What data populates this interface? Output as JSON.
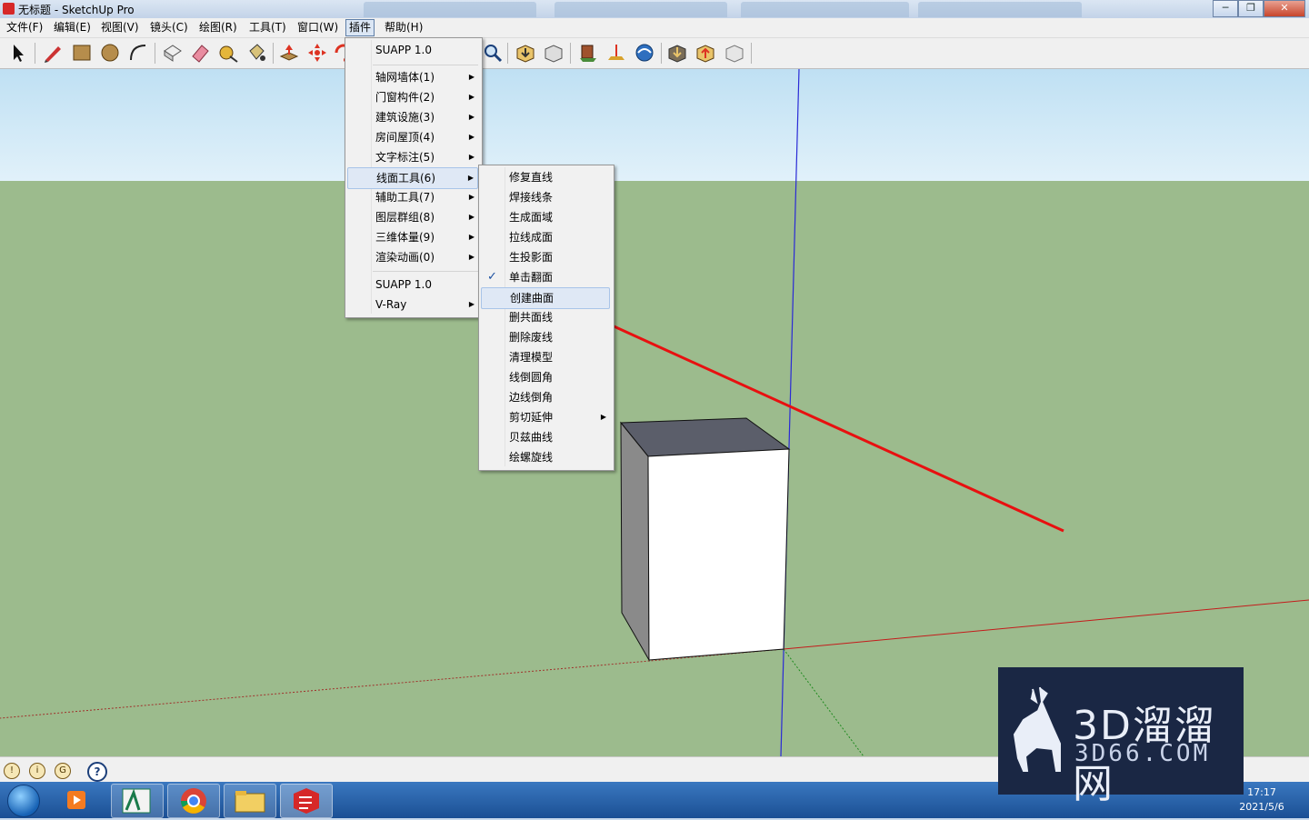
{
  "window": {
    "title": "无标题 - SketchUp Pro",
    "minimize": "─",
    "maximize": "❐",
    "close": "✕"
  },
  "menubar": [
    {
      "label": "文件(F)"
    },
    {
      "label": "编辑(E)"
    },
    {
      "label": "视图(V)"
    },
    {
      "label": "镜头(C)"
    },
    {
      "label": "绘图(R)"
    },
    {
      "label": "工具(T)"
    },
    {
      "label": "窗口(W)"
    },
    {
      "label": "插件",
      "active": true
    },
    {
      "label": "帮助(H)"
    }
  ],
  "plugin_menu": {
    "header": "SUAPP 1.0",
    "items": [
      {
        "label": "轴网墙体(1)",
        "submenu": true
      },
      {
        "label": "门窗构件(2)",
        "submenu": true
      },
      {
        "label": "建筑设施(3)",
        "submenu": true
      },
      {
        "label": "房间屋顶(4)",
        "submenu": true
      },
      {
        "label": "文字标注(5)",
        "submenu": true
      },
      {
        "label": "线面工具(6)",
        "submenu": true,
        "highlighted": true
      },
      {
        "label": "辅助工具(7)",
        "submenu": true
      },
      {
        "label": "图层群组(8)",
        "submenu": true
      },
      {
        "label": "三维体量(9)",
        "submenu": true
      },
      {
        "label": "渲染动画(0)",
        "submenu": true
      }
    ],
    "footer_items": [
      {
        "label": "SUAPP 1.0",
        "submenu": false
      },
      {
        "label": "V-Ray",
        "submenu": true
      }
    ]
  },
  "line_tools_submenu": [
    {
      "label": "修复直线"
    },
    {
      "label": "焊接线条"
    },
    {
      "label": "生成面域"
    },
    {
      "label": "拉线成面"
    },
    {
      "label": "生投影面"
    },
    {
      "label": "单击翻面",
      "checked": true
    },
    {
      "label": "创建曲面",
      "highlighted": true
    },
    {
      "label": "删共面线"
    },
    {
      "label": "删除废线"
    },
    {
      "label": "清理模型"
    },
    {
      "label": "线倒圆角"
    },
    {
      "label": "边线倒角"
    },
    {
      "label": "剪切延伸",
      "submenu": true
    },
    {
      "label": "贝兹曲线"
    },
    {
      "label": "绘螺旋线"
    }
  ],
  "statusbar": {
    "help": "?"
  },
  "taskbar": {
    "time": "17:17",
    "date": "2021/5/6"
  },
  "watermark": {
    "line1": "3D溜溜网",
    "line2": "3D66.COM"
  },
  "colors": {
    "sky": "#c8e6f5",
    "ground": "#9cbb8d",
    "annotation_arrow": "#e81010",
    "menu_highlight": "#dfe8f5"
  }
}
